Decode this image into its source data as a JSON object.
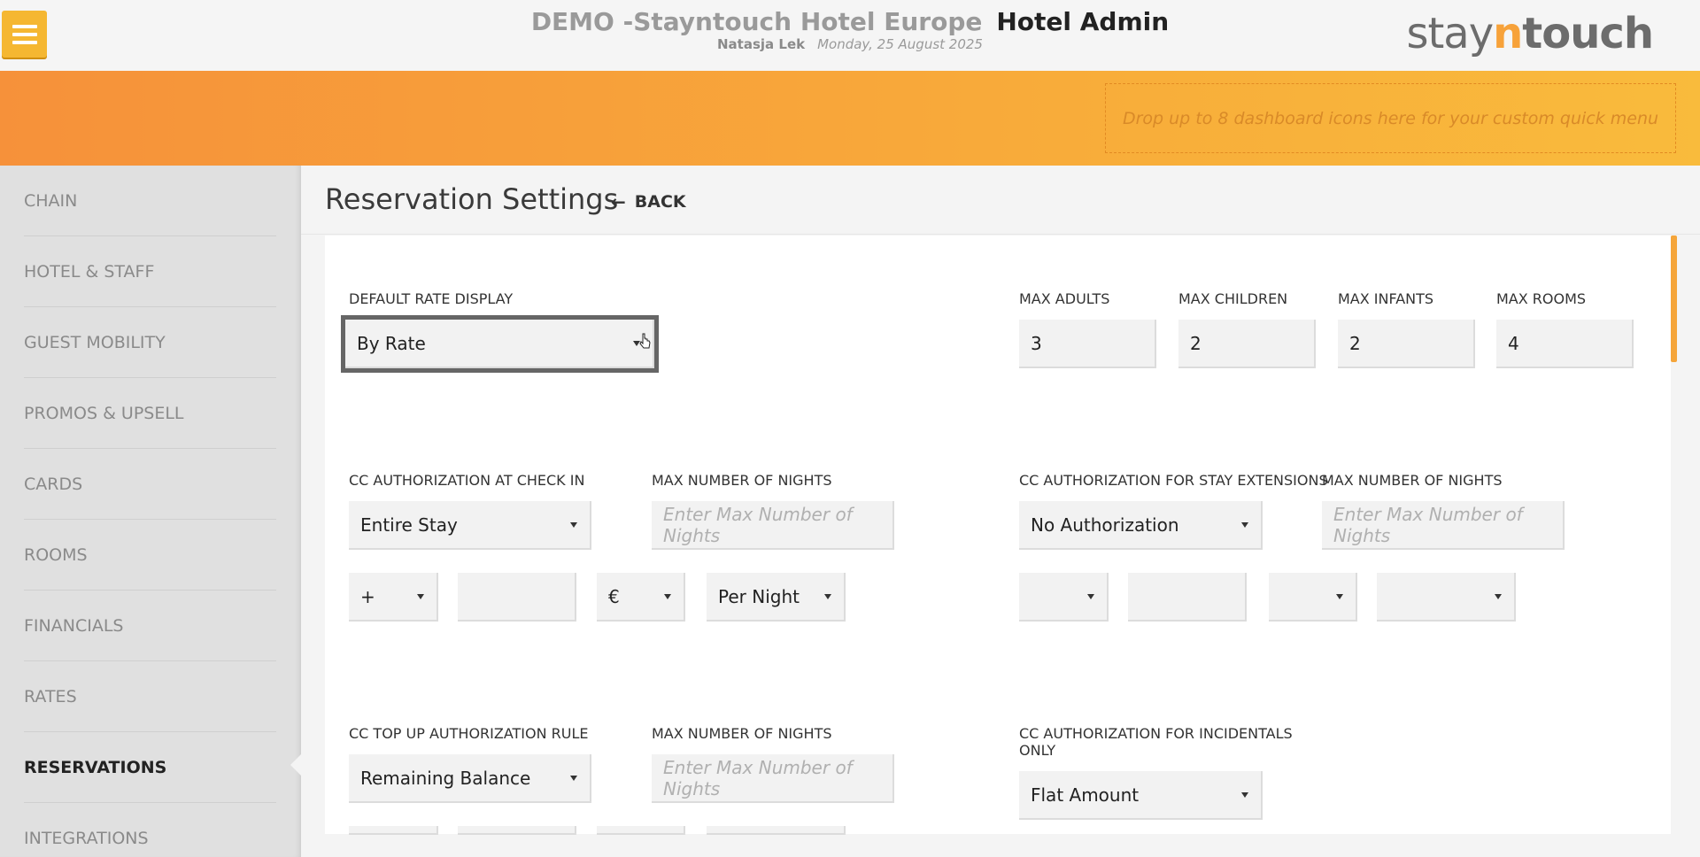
{
  "header": {
    "hotel_name": "DEMO -Stayntouch Hotel Europe",
    "section_title": "Hotel Admin",
    "user_name": "Natasja Lek",
    "date": "Monday, 25 August 2025",
    "logo": {
      "part1": "stay",
      "part2": "n",
      "part3": "touch"
    }
  },
  "banner": {
    "dropzone_text": "Drop up to 8 dashboard icons here for your custom quick menu"
  },
  "sidebar": {
    "items": [
      {
        "label": "CHAIN"
      },
      {
        "label": "HOTEL & STAFF"
      },
      {
        "label": "GUEST MOBILITY"
      },
      {
        "label": "PROMOS & UPSELL"
      },
      {
        "label": "CARDS"
      },
      {
        "label": "ROOMS"
      },
      {
        "label": "FINANCIALS"
      },
      {
        "label": "RATES"
      },
      {
        "label": "RESERVATIONS"
      },
      {
        "label": "INTEGRATIONS"
      }
    ],
    "active": "RESERVATIONS"
  },
  "page": {
    "title": "Reservation Settings",
    "back_label": "BACK"
  },
  "form": {
    "default_rate_display": {
      "label": "DEFAULT RATE DISPLAY",
      "value": "By Rate"
    },
    "max_adults": {
      "label": "MAX ADULTS",
      "value": "3"
    },
    "max_children": {
      "label": "MAX CHILDREN",
      "value": "2"
    },
    "max_infants": {
      "label": "MAX INFANTS",
      "value": "2"
    },
    "max_rooms": {
      "label": "MAX ROOMS",
      "value": "4"
    },
    "cc_auth_checkin": {
      "label": "CC AUTHORIZATION AT CHECK IN",
      "value": "Entire Stay"
    },
    "max_nights_1": {
      "label": "MAX NUMBER OF NIGHTS",
      "placeholder": "Enter Max Number of Nights"
    },
    "checkin_sign": {
      "value": "+"
    },
    "checkin_amount": {
      "value": ""
    },
    "checkin_currency": {
      "value": "€"
    },
    "checkin_period": {
      "value": "Per Night"
    },
    "cc_auth_extensions": {
      "label": "CC AUTHORIZATION FOR STAY EXTENSIONS",
      "value": "No Authorization"
    },
    "max_nights_2": {
      "label": "MAX NUMBER OF NIGHTS",
      "placeholder": "Enter Max Number of Nights"
    },
    "ext_sign": {
      "value": ""
    },
    "ext_amount": {
      "value": ""
    },
    "ext_currency": {
      "value": ""
    },
    "ext_period": {
      "value": ""
    },
    "cc_topup": {
      "label": "CC TOP UP AUTHORIZATION RULE",
      "value": "Remaining Balance"
    },
    "max_nights_3": {
      "label": "MAX NUMBER OF NIGHTS",
      "placeholder": "Enter Max Number of Nights"
    },
    "cc_incidentals": {
      "label_line1": "CC AUTHORIZATION FOR INCIDENTALS",
      "label_line2": "ONLY",
      "value": "Flat Amount"
    }
  },
  "colors": {
    "accent_orange": "#f6913a",
    "menu_yellow": "#f5b731"
  }
}
